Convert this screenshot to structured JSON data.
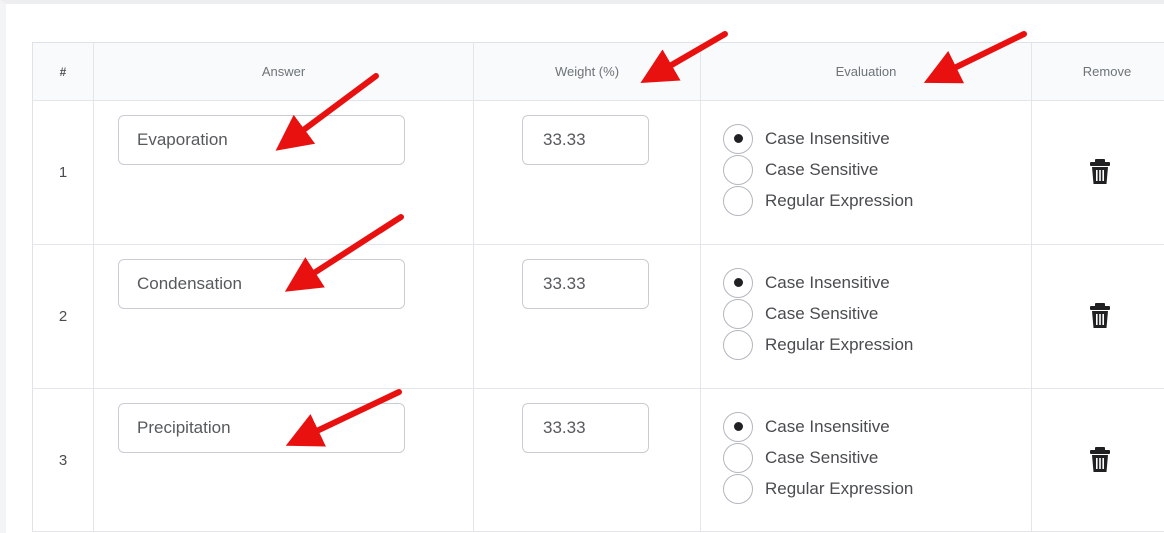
{
  "table": {
    "headers": {
      "number": "#",
      "answer": "Answer",
      "weight": "Weight (%)",
      "evaluation": "Evaluation",
      "remove": "Remove"
    },
    "rows": [
      {
        "number": "1",
        "answer": "Evaporation",
        "weight": "33.33",
        "evaluation_options": [
          "Case Insensitive",
          "Case Sensitive",
          "Regular Expression"
        ],
        "selected": "Case Insensitive",
        "remove_icon": "trash-icon"
      },
      {
        "number": "2",
        "answer": "Condensation",
        "weight": "33.33",
        "evaluation_options": [
          "Case Insensitive",
          "Case Sensitive",
          "Regular Expression"
        ],
        "selected": "Case Insensitive",
        "remove_icon": "trash-icon"
      },
      {
        "number": "3",
        "answer": "Precipitation",
        "weight": "33.33",
        "evaluation_options": [
          "Case Insensitive",
          "Case Sensitive",
          "Regular Expression"
        ],
        "selected": "Case Insensitive",
        "remove_icon": "trash-icon"
      }
    ]
  },
  "annotations": {
    "arrow_color": "#e8110f",
    "arrow_icon": "red-arrow-icon"
  }
}
